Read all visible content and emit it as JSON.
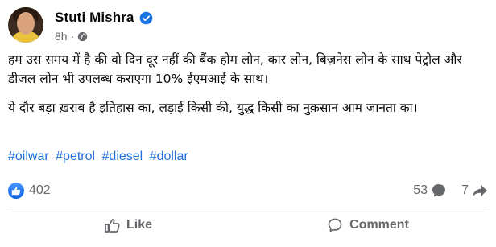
{
  "author": {
    "name": "Stuti Mishra",
    "time": "8h",
    "separator": "·",
    "verified_icon": "verified-badge-icon",
    "audience_icon": "globe-icon"
  },
  "post": {
    "paragraph1": "हम उस समय में है की वो दिन दूर नहीं की बैंक होम लोन, कार लोन, बिज़नेस लोन के साथ पेट्रोल और डीजल लोन भी उपलब्ध कराएगा 10% ईएमआई के साथ।",
    "paragraph2": "ये दौर बड़ा ख़राब है इतिहास का, लड़ाई किसी की, युद्ध किसी का  नुक़सान आम जानता का।",
    "hashtags": [
      "#oilwar",
      "#petrol",
      "#diesel",
      "#dollar"
    ]
  },
  "stats": {
    "reactions": "402",
    "comments": "53",
    "shares": "7"
  },
  "actions": {
    "like": "Like",
    "comment": "Comment"
  },
  "colors": {
    "accent": "#216fdb",
    "verified": "#1b74e4",
    "secondary_text": "#65676b",
    "like_badge": "#0a66e4"
  }
}
